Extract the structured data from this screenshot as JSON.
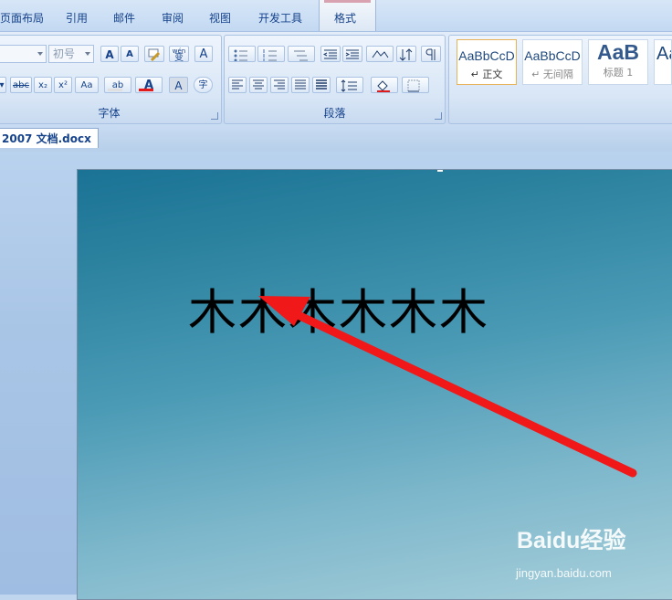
{
  "tabs": [
    "页面布局",
    "引用",
    "邮件",
    "审阅",
    "视图",
    "开发工具",
    "格式"
  ],
  "font_group": {
    "font_size_value": "初号",
    "grow_label": "A",
    "shrink_label": "A",
    "phonetic_label": "wén",
    "phonetic_char": "变",
    "char_border_label": "A",
    "strike_label": "abc",
    "sub_label": "x₂",
    "sup_label": "x²",
    "case_label": "Aa",
    "highlight_label": "ab",
    "font_color_label": "A",
    "char_shading_label": "A",
    "enclose_label": "字",
    "group_label": "字体"
  },
  "paragraph_group": {
    "group_label": "段落"
  },
  "styles": [
    {
      "sample": "AaBbCcD",
      "name": "↵ 正文"
    },
    {
      "sample": "AaBbCcD",
      "name": "↵ 无间隔"
    },
    {
      "sample": "AaB",
      "name": "标题 1"
    },
    {
      "sample": "Aa",
      "name": ""
    }
  ],
  "document": {
    "tab_title": "2007 文档.docx *",
    "body_text": "木木木木木木"
  },
  "watermark": {
    "brand": "Baidu经验",
    "url": "jingyan.baidu.com"
  },
  "colors": {
    "font_color_underline": "#e11b1b",
    "highlight_underline": "#e0e0e0",
    "arrow": "#f01818"
  }
}
